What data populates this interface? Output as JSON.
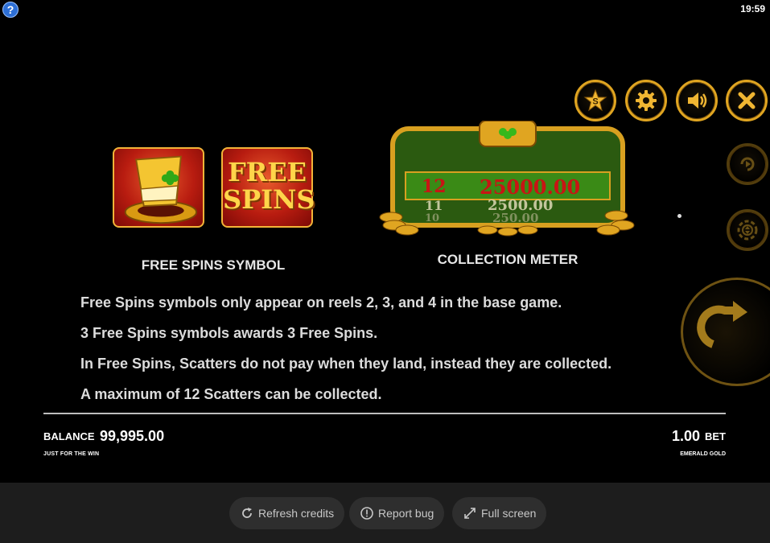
{
  "status": {
    "time": "19:59",
    "help_glyph": "?"
  },
  "controls": {
    "top_row": [
      "star-s-icon",
      "gear-icon",
      "speaker-icon",
      "close-icon"
    ],
    "side": [
      "autoplay-icon",
      "bet-chip-icon",
      "spin-icon"
    ]
  },
  "symbols": {
    "free_spins": {
      "label": "FREE SPINS SYMBOL",
      "badge_text_1": "FREE",
      "badge_text_2": "SPINS"
    },
    "collection": {
      "label": "COLLECTION METER",
      "rows": [
        {
          "count": "12",
          "value": "25000.00"
        },
        {
          "count": "11",
          "value": "2500.00"
        },
        {
          "count": "10",
          "value": "250.00"
        }
      ]
    }
  },
  "info_lines": [
    "Free Spins symbols only appear on reels 2, 3, and 4 in the base game.",
    "3 Free Spins symbols awards 3 Free Spins.",
    "In Free Spins, Scatters do not pay when they land, instead they are collected.",
    "A maximum of 12 Scatters can be collected."
  ],
  "footer": {
    "balance_label": "BALANCE",
    "balance_value": "99,995.00",
    "left_sub": "JUST FOR THE WIN",
    "bet_value": "1.00",
    "bet_label": "BET",
    "right_sub": "EMERALD GOLD"
  },
  "bottom_bar": {
    "refresh": "Refresh credits",
    "report": "Report bug",
    "fullscreen": "Full screen"
  },
  "colors": {
    "gold": "#e0a521",
    "green": "#2f8a18",
    "red": "#b81c10"
  }
}
